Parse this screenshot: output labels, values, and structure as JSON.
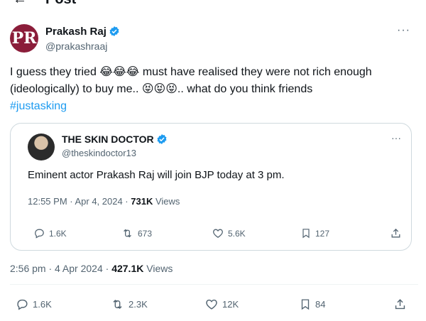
{
  "header": {
    "title": "Post"
  },
  "post": {
    "author": {
      "name": "Prakash Raj",
      "handle": "@prakashraaj",
      "avatar_text": "PR",
      "avatar_color": "#8b1d3a"
    },
    "text_line1": "I guess they tried 😂😂😂 must have realised they were not rich enough",
    "text_line2": "(ideologically) to buy me.. 😝😝😝.. what do you think friends",
    "hashtag": "#justasking",
    "time": "2:56 pm · 4 Apr 2024 · ",
    "views_count": "427.1K",
    "views_label": " Views",
    "stats": {
      "replies": "1.6K",
      "reposts": "2.3K",
      "likes": "12K",
      "bookmarks": "84"
    }
  },
  "quoted": {
    "author": {
      "name": "THE SKIN DOCTOR",
      "handle": "@theskindoctor13"
    },
    "text": "Eminent actor Prakash Raj will join BJP today at 3 pm.",
    "time": "12:55 PM · Apr 4, 2024 · ",
    "views_count": "731K",
    "views_label": " Views",
    "stats": {
      "replies": "1.6K",
      "reposts": "673",
      "likes": "5.6K",
      "bookmarks": "127"
    }
  },
  "colors": {
    "accent": "#1d9bf0",
    "muted": "#536471",
    "border": "#cfd9de"
  }
}
